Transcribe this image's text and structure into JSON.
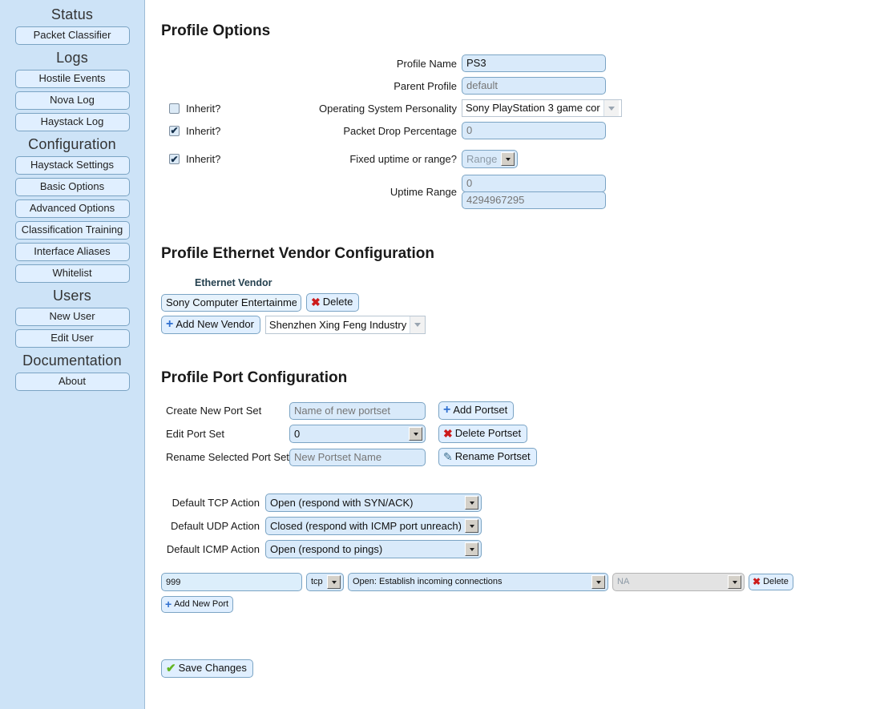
{
  "sidebar": {
    "groups": [
      {
        "heading": "Status",
        "items": [
          {
            "label": "Packet Classifier",
            "name": "packet-classifier"
          }
        ]
      },
      {
        "heading": "Logs",
        "items": [
          {
            "label": "Hostile Events",
            "name": "hostile-events"
          },
          {
            "label": "Nova Log",
            "name": "nova-log"
          },
          {
            "label": "Haystack Log",
            "name": "haystack-log"
          }
        ]
      },
      {
        "heading": "Configuration",
        "items": [
          {
            "label": "Haystack Settings",
            "name": "haystack-settings"
          },
          {
            "label": "Basic Options",
            "name": "basic-options"
          },
          {
            "label": "Advanced Options",
            "name": "advanced-options"
          },
          {
            "label": "Classification Training",
            "name": "classification-training"
          },
          {
            "label": "Interface Aliases",
            "name": "interface-aliases"
          },
          {
            "label": "Whitelist",
            "name": "whitelist"
          }
        ]
      },
      {
        "heading": "Users",
        "items": [
          {
            "label": "New User",
            "name": "new-user"
          },
          {
            "label": "Edit User",
            "name": "edit-user"
          }
        ]
      },
      {
        "heading": "Documentation",
        "items": [
          {
            "label": "About",
            "name": "about"
          }
        ]
      }
    ]
  },
  "profile_options": {
    "title": "Profile Options",
    "profile_name": {
      "label": "Profile Name",
      "value": "PS3"
    },
    "parent_profile": {
      "label": "Parent Profile",
      "placeholder": "default",
      "value": ""
    },
    "os_personality": {
      "label": "Operating System Personality",
      "inherit_label": "Inherit?",
      "inherit_checked": false,
      "value": "Sony PlayStation 3 game cor"
    },
    "packet_drop": {
      "label": "Packet Drop Percentage",
      "inherit_label": "Inherit?",
      "inherit_checked": true,
      "placeholder": "0",
      "value": ""
    },
    "uptime_mode": {
      "label": "Fixed uptime or range?",
      "inherit_label": "Inherit?",
      "inherit_checked": true,
      "value": "Range"
    },
    "uptime_range": {
      "label": "Uptime Range",
      "min_placeholder": "0",
      "max_placeholder": "4294967295",
      "min_value": "",
      "max_value": ""
    }
  },
  "vendor_section": {
    "title": "Profile Ethernet Vendor Configuration",
    "column_header": "Ethernet Vendor",
    "rows": [
      {
        "name": "Sony Computer Entertainmer",
        "delete_label": "Delete"
      }
    ],
    "add_label": "Add New Vendor",
    "new_vendor_selected": "Shenzhen Xing Feng Industry"
  },
  "port_section": {
    "title": "Profile Port Configuration",
    "create_portset": {
      "label": "Create New Port Set",
      "placeholder": "Name of new portset",
      "value": "",
      "button": "Add Portset"
    },
    "edit_portset": {
      "label": "Edit Port Set",
      "value": "0",
      "button": "Delete Portset"
    },
    "rename_portset": {
      "label": "Rename Selected Port Set",
      "placeholder": "New Portset Name",
      "value": "",
      "button": "Rename Portset"
    },
    "defaults": [
      {
        "label": "Default TCP Action",
        "value": "Open (respond with SYN/ACK)",
        "name": "default-tcp-action"
      },
      {
        "label": "Default UDP Action",
        "value": "Closed (respond with ICMP port unreach)",
        "name": "default-udp-action"
      },
      {
        "label": "Default ICMP Action",
        "value": "Open (respond to pings)",
        "name": "default-icmp-action"
      }
    ],
    "ports": [
      {
        "number": "999",
        "protocol": "tcp",
        "behavior": "Open: Establish incoming connections",
        "script": "NA",
        "script_disabled": true,
        "delete_label": "Delete"
      }
    ],
    "add_port_label": "Add New Port"
  },
  "footer": {
    "save_label": "Save Changes"
  },
  "icons": {
    "plus": "+",
    "cross": "✖",
    "check": "✔",
    "pencil": "✎",
    "checkmark": "✔"
  },
  "colors": {
    "sidebar_bg": "#cde3f7",
    "button_bg": "#e0efff",
    "input_bg": "#d9eafa",
    "border": "#7ba4c4",
    "plus_blue": "#2f6fd0",
    "delete_red": "#cc1b1b",
    "check_green": "#62b521"
  }
}
